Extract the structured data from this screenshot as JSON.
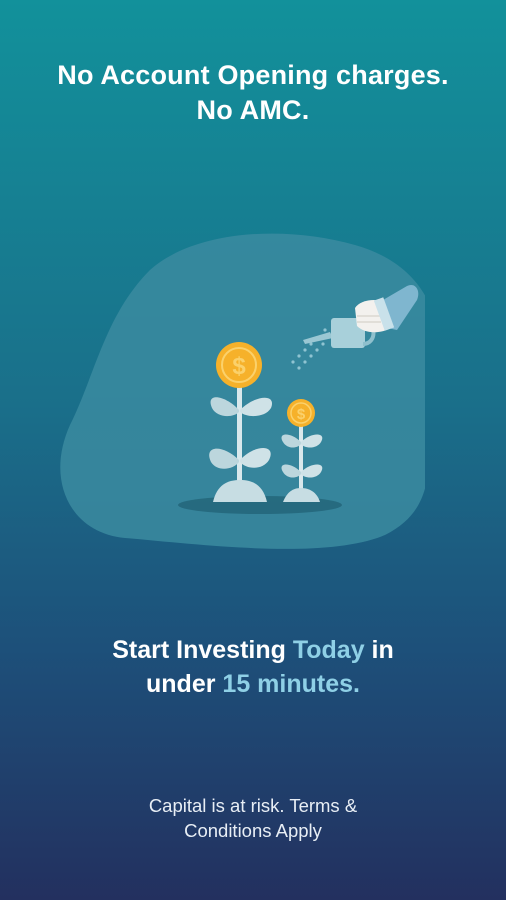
{
  "header": {
    "line1": "No Account Opening charges.",
    "line2": "No AMC."
  },
  "illustration": {
    "icon": "money-plant-watering-icon",
    "coin_symbol": "$"
  },
  "tagline": {
    "part1": "Start Investing ",
    "highlight1": "Today",
    "part2": " in",
    "part3": "under ",
    "highlight2": "15 minutes."
  },
  "footer": {
    "line1": "Capital is at risk. Terms &",
    "line2": "Conditions Apply"
  },
  "colors": {
    "gradient_top": "#12919b",
    "gradient_bottom": "#23305f",
    "highlight": "#8fd0e6",
    "coin": "#f6b12a"
  }
}
